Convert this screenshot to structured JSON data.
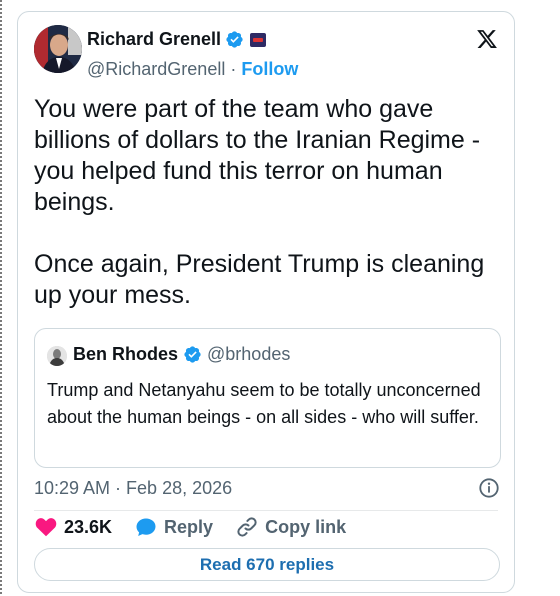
{
  "tweet": {
    "author": {
      "name": "Richard Grenell",
      "handle": "@RichardGrenell",
      "follow_label": "Follow",
      "separator": "·"
    },
    "text_paragraphs": [
      "You were part of the team who gave billions of dollars to the Iranian Regime - you helped fund this terror on human beings.",
      "Once again, President Trump is cleaning up your mess."
    ],
    "quoted": {
      "name": "Ben Rhodes",
      "handle": "@brhodes",
      "text": "Trump and Netanyahu seem to be totally unconcerned about the human beings - on all sides - who will suffer."
    },
    "timestamp": "10:29 AM · Feb 28, 2026",
    "actions": {
      "likes": "23.6K",
      "reply_label": "Reply",
      "copy_link_label": "Copy link"
    },
    "read_replies_label": "Read 670 replies"
  },
  "colors": {
    "accent": "#1d9bf0",
    "like": "#f91880",
    "secondary_text": "#536471",
    "border": "#cfd9de"
  },
  "icons": [
    "verified-badge-icon",
    "affiliation-badge-icon",
    "x-logo-icon",
    "info-icon",
    "heart-icon",
    "reply-bubble-icon",
    "link-icon"
  ]
}
